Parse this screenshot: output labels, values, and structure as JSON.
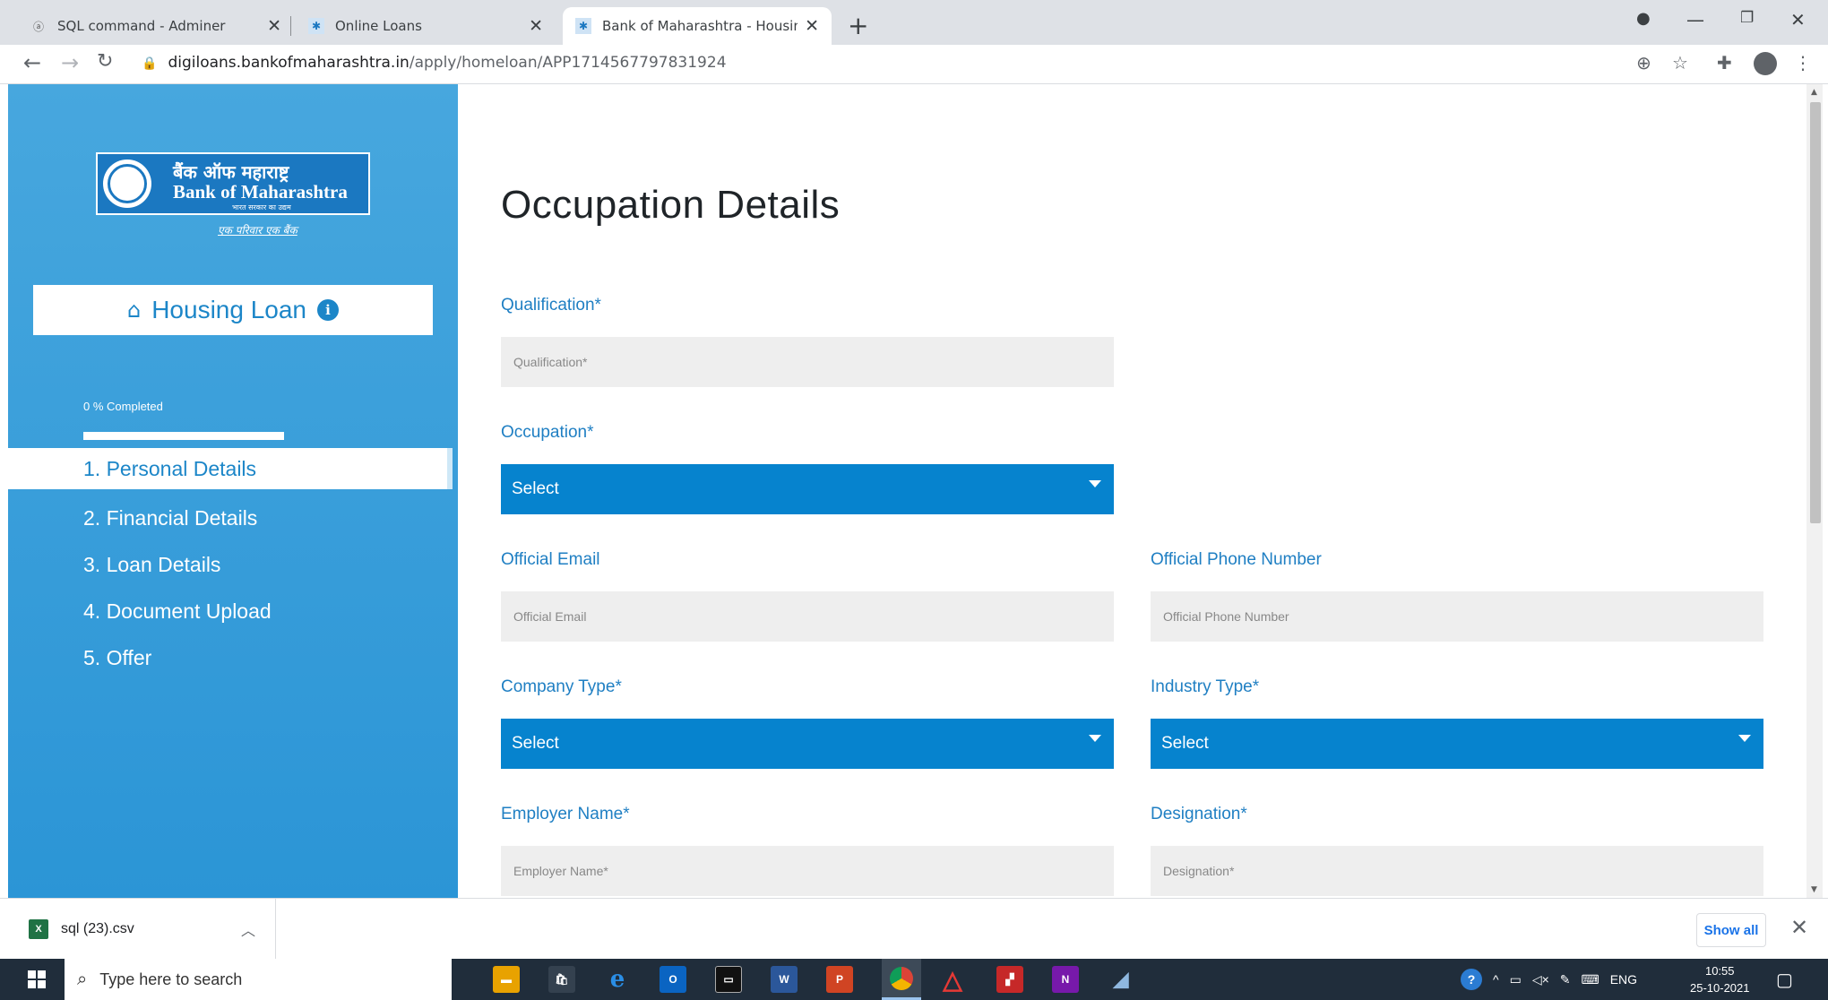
{
  "browser": {
    "tabs": [
      {
        "title": "SQL command - Adminer",
        "active": false
      },
      {
        "title": "Online Loans",
        "active": false
      },
      {
        "title": "Bank of Maharashtra - Housing L",
        "active": true
      }
    ],
    "url_domain": "digiloans.bankofmaharashtra.in",
    "url_path": "/apply/homeloan/APP1714567797831924"
  },
  "sidebar": {
    "logo": {
      "hindi": "बैंक ऑफ महाराष्ट्र",
      "english": "Bank of Maharashtra",
      "subtitle": "भारत सरकार का उद्यम",
      "tagline": "एक परिवार एक बैंक"
    },
    "loan_type": "Housing Loan",
    "progress_label": "0 % Completed",
    "progress_value": 0,
    "steps": [
      {
        "label": "1. Personal Details",
        "active": true
      },
      {
        "label": "2. Financial Details",
        "active": false
      },
      {
        "label": "3. Loan Details",
        "active": false
      },
      {
        "label": "4. Document Upload",
        "active": false
      },
      {
        "label": "5. Offer",
        "active": false
      }
    ]
  },
  "form": {
    "title": "Occupation Details",
    "qualification": {
      "label": "Qualification*",
      "placeholder": "Qualification*"
    },
    "occupation": {
      "label": "Occupation*",
      "value": "Select"
    },
    "official_email": {
      "label": "Official Email",
      "placeholder": "Official Email"
    },
    "official_phone": {
      "label": "Official Phone Number",
      "placeholder": "Official Phone Number"
    },
    "company_type": {
      "label": "Company Type*",
      "value": "Select"
    },
    "industry_type": {
      "label": "Industry Type*",
      "value": "Select"
    },
    "employer_name": {
      "label": "Employer Name*",
      "placeholder": "Employer Name*"
    },
    "designation": {
      "label": "Designation*",
      "placeholder": "Designation*"
    }
  },
  "downloads": {
    "file_name": "sql (23).csv",
    "show_all": "Show all"
  },
  "taskbar": {
    "search_placeholder": "Type here to search",
    "language": "ENG",
    "time": "10:55",
    "date": "25-10-2021"
  },
  "colors": {
    "sidebar_blue": "#3aa0db",
    "select_blue": "#0683ce",
    "label_blue": "#1f7fc3"
  }
}
